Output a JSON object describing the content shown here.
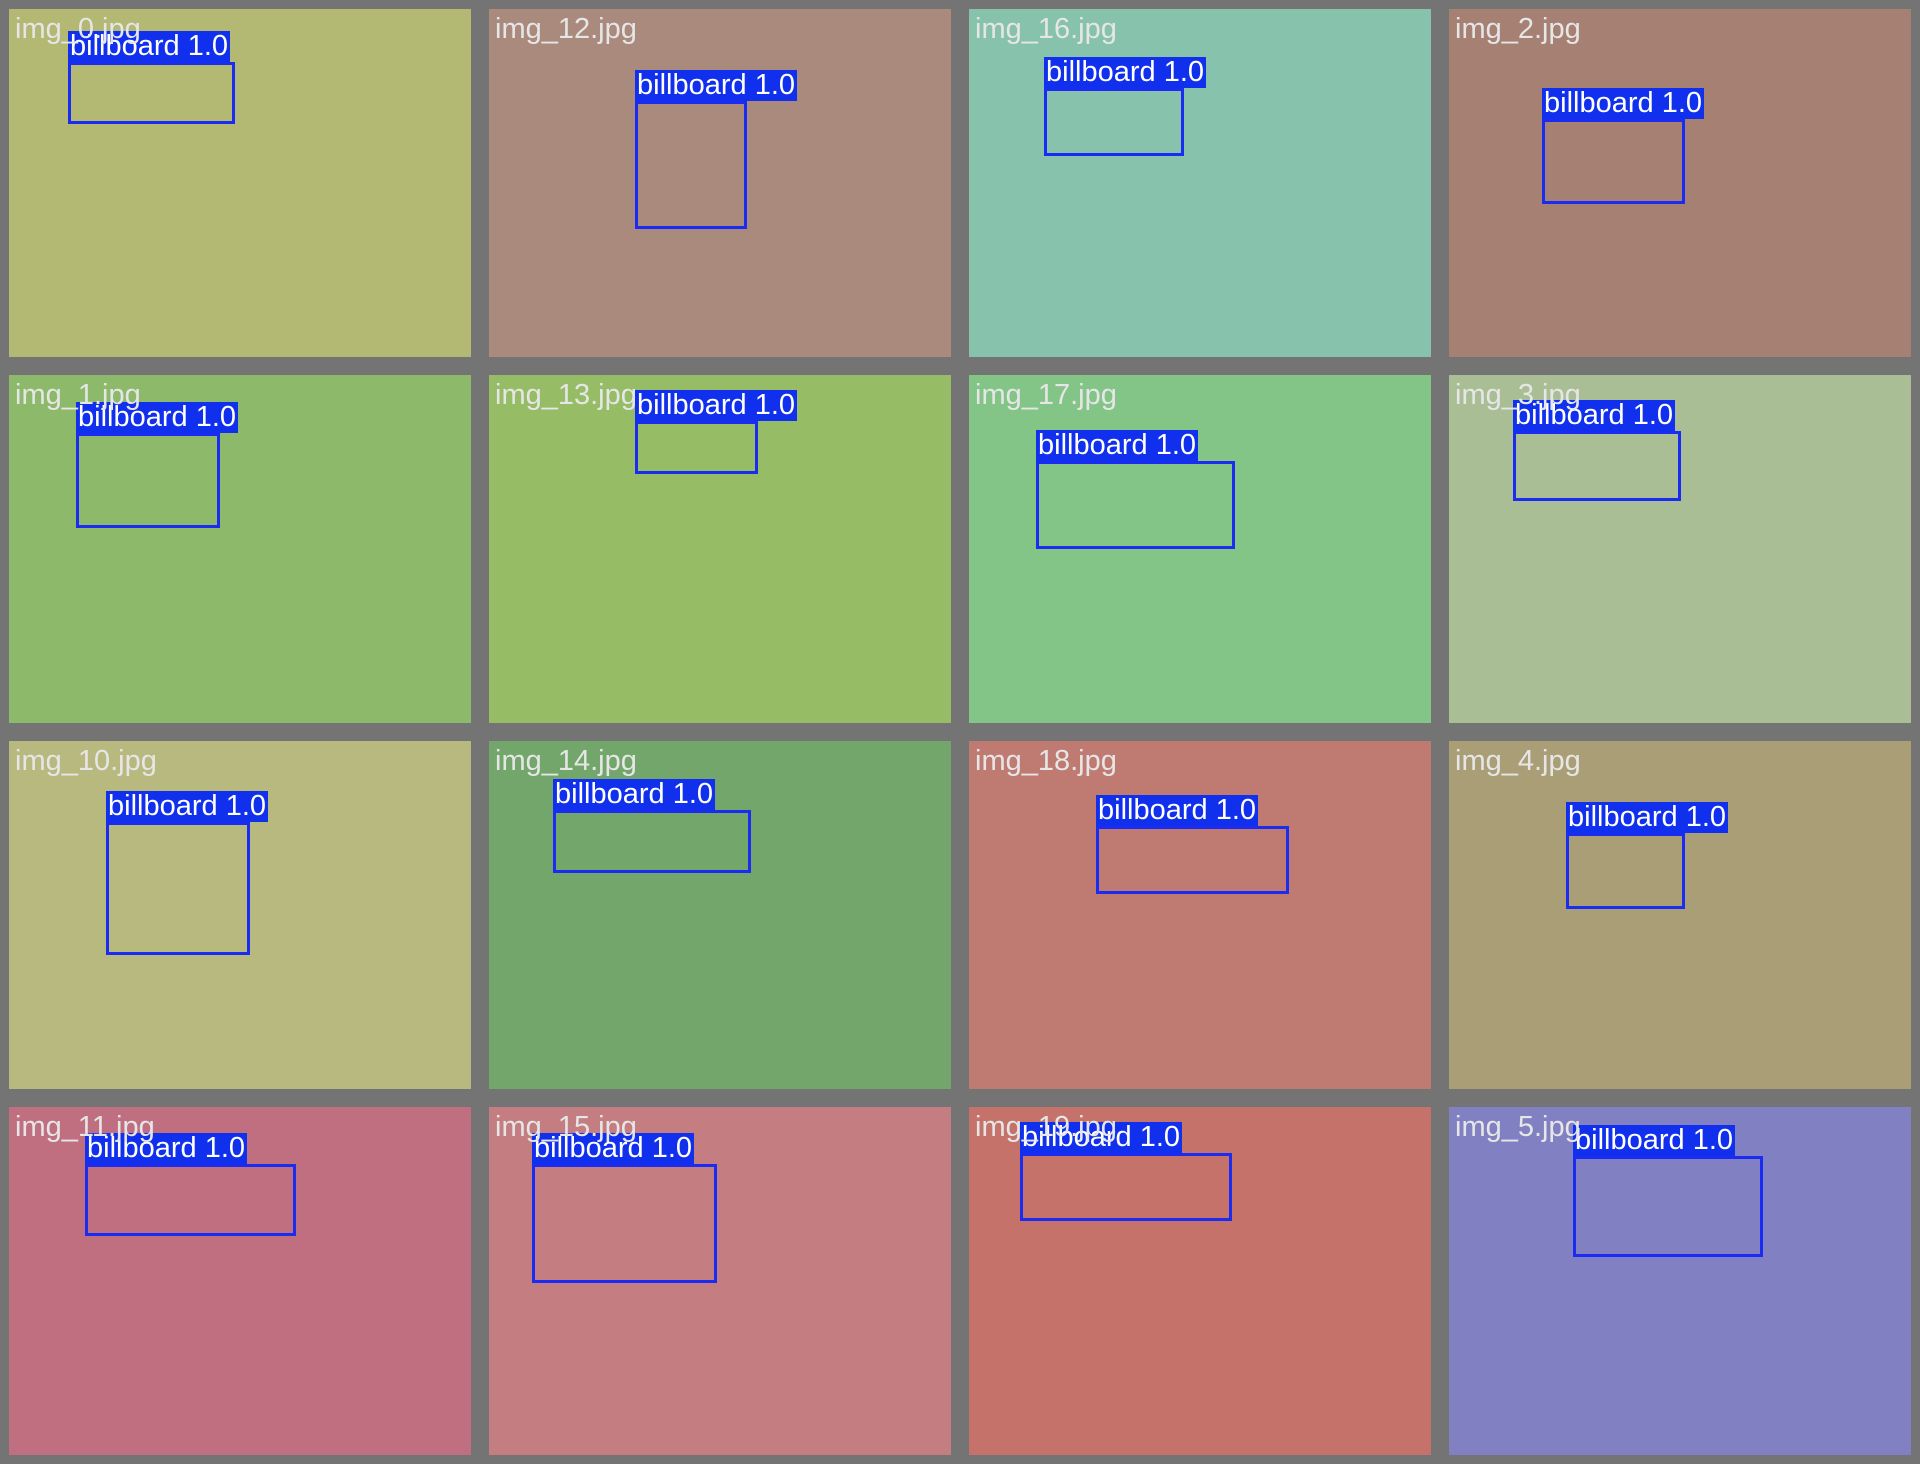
{
  "grid": {
    "tiles": [
      {
        "name": "img_0.jpg",
        "color": "#b3b872",
        "detections": [
          {
            "label": "billboard",
            "score": "1.0"
          }
        ]
      },
      {
        "name": "img_12.jpg",
        "color": "#a98a7d",
        "detections": [
          {
            "label": "billboard",
            "score": "1.0"
          }
        ]
      },
      {
        "name": "img_16.jpg",
        "color": "#87c2ac",
        "detections": [
          {
            "label": "billboard",
            "score": "1.0"
          }
        ]
      },
      {
        "name": "img_2.jpg",
        "color": "#a68073",
        "detections": [
          {
            "label": "billboard",
            "score": "1.0"
          }
        ]
      },
      {
        "name": "img_1.jpg",
        "color": "#8db96a",
        "detections": [
          {
            "label": "billboard",
            "score": "1.0"
          }
        ]
      },
      {
        "name": "img_13.jpg",
        "color": "#96bc66",
        "detections": [
          {
            "label": "billboard",
            "score": "1.0"
          }
        ]
      },
      {
        "name": "img_17.jpg",
        "color": "#83c487",
        "detections": [
          {
            "label": "billboard",
            "score": "1.0"
          }
        ]
      },
      {
        "name": "img_3.jpg",
        "color": "#aabe95",
        "detections": [
          {
            "label": "billboard",
            "score": "1.0"
          }
        ]
      },
      {
        "name": "img_10.jpg",
        "color": "#b8b97f",
        "detections": [
          {
            "label": "billboard",
            "score": "1.0"
          }
        ]
      },
      {
        "name": "img_14.jpg",
        "color": "#72a66a",
        "detections": [
          {
            "label": "billboard",
            "score": "1.0"
          }
        ]
      },
      {
        "name": "img_18.jpg",
        "color": "#bf7b72",
        "detections": [
          {
            "label": "billboard",
            "score": "1.0"
          }
        ]
      },
      {
        "name": "img_4.jpg",
        "color": "#aa9e77",
        "detections": [
          {
            "label": "billboard",
            "score": "1.0"
          }
        ]
      },
      {
        "name": "img_11.jpg",
        "color": "#c06f81",
        "detections": [
          {
            "label": "billboard",
            "score": "1.0"
          }
        ]
      },
      {
        "name": "img_15.jpg",
        "color": "#c47d80",
        "detections": [
          {
            "label": "billboard",
            "score": "1.0"
          }
        ]
      },
      {
        "name": "img_19.jpg",
        "color": "#c5736a",
        "detections": [
          {
            "label": "billboard",
            "score": "1.0"
          }
        ]
      },
      {
        "name": "img_5.jpg",
        "color": "#8080c2",
        "detections": [
          {
            "label": "billboard",
            "score": "1.0"
          }
        ]
      }
    ]
  }
}
